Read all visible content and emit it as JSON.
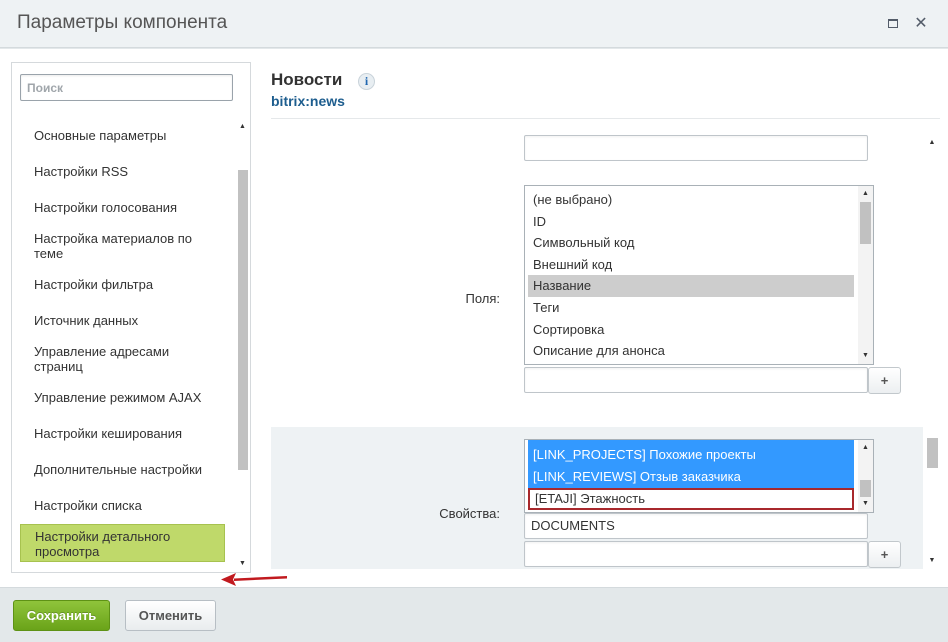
{
  "dialog": {
    "title": "Параметры компонента"
  },
  "sidebar": {
    "search_placeholder": "Поиск",
    "items": [
      {
        "label": "Основные параметры"
      },
      {
        "label": "Настройки RSS"
      },
      {
        "label": "Настройки голосования"
      },
      {
        "label": "Настройка материалов по теме"
      },
      {
        "label": "Настройки фильтра"
      },
      {
        "label": "Источник данных"
      },
      {
        "label": "Управление адресами страниц"
      },
      {
        "label": "Управление режимом AJAX"
      },
      {
        "label": "Настройки кеширования"
      },
      {
        "label": "Дополнительные настройки"
      },
      {
        "label": "Настройки списка"
      },
      {
        "label": "Настройки детального просмотра",
        "active": true
      }
    ],
    "active_color": "#bfd96a"
  },
  "component": {
    "name": "Новости",
    "id": "bitrix:news"
  },
  "fields": {
    "label": "Поля:",
    "options": [
      {
        "label": "(не выбрано)"
      },
      {
        "label": "ID"
      },
      {
        "label": "Символьный код"
      },
      {
        "label": "Внешний код"
      },
      {
        "label": "Название",
        "selected": true
      },
      {
        "label": "Теги"
      },
      {
        "label": "Сортировка"
      },
      {
        "label": "Описание для анонса"
      }
    ],
    "extra_value": "",
    "add_label": "+"
  },
  "properties": {
    "label": "Свойства:",
    "options": [
      {
        "label": "[LINK_PROJECTS] Похожие проекты",
        "selected": true
      },
      {
        "label": "[LINK_REVIEWS] Отзыв заказчика",
        "selected": true
      },
      {
        "label": "[ETAJI] Этажность",
        "outlined": true
      }
    ],
    "inputs": [
      "DOCUMENTS",
      ""
    ],
    "add_label": "+",
    "selected_color": "#3399ff",
    "outline_color": "#a8282c"
  },
  "footer": {
    "save_label": "Сохранить",
    "cancel_label": "Отменить",
    "save_color": "#7ab12a"
  },
  "icons": [
    "maximize-icon",
    "close-icon",
    "info-icon",
    "pointer-arrow-icon",
    "scroll-up-icon",
    "scroll-down-icon"
  ]
}
